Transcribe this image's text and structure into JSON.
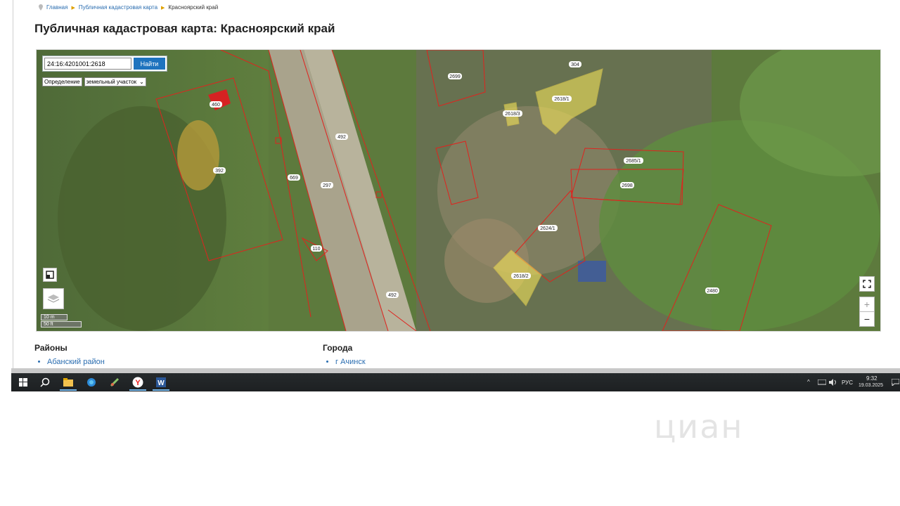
{
  "breadcrumbs": [
    "Главная",
    "Публичная кадастровая карта",
    "Красноярский край"
  ],
  "page_title": "Публичная кадастровая карта: Красноярский край",
  "map": {
    "search_value": "24:16:4201001:2618",
    "search_button": "Найти",
    "definition_label": "Определение",
    "definition_value": "земельный участок",
    "scale_m": "10 m",
    "scale_ft": "50 ft",
    "zoom_in": "+",
    "zoom_out": "−",
    "parcel_labels": [
      "2699",
      "304",
      "2618/1",
      "2618/3",
      "492",
      "392",
      "669",
      "297",
      "2685/1",
      "2698",
      "2624/1",
      "2618/2",
      "2480",
      "110",
      "492",
      "460"
    ]
  },
  "districts": {
    "heading": "Районы",
    "items": [
      "Абанский район"
    ]
  },
  "cities": {
    "heading": "Города",
    "items": [
      "г Ачинск"
    ]
  },
  "taskbar": {
    "lang": "РУС",
    "time": "9:32",
    "date": "19.03.2025"
  },
  "watermark": "циан",
  "colors": {
    "boundary": "#e0231e",
    "highlight": "#f2e35a",
    "link": "#2a6db0",
    "button": "#1e73be"
  }
}
